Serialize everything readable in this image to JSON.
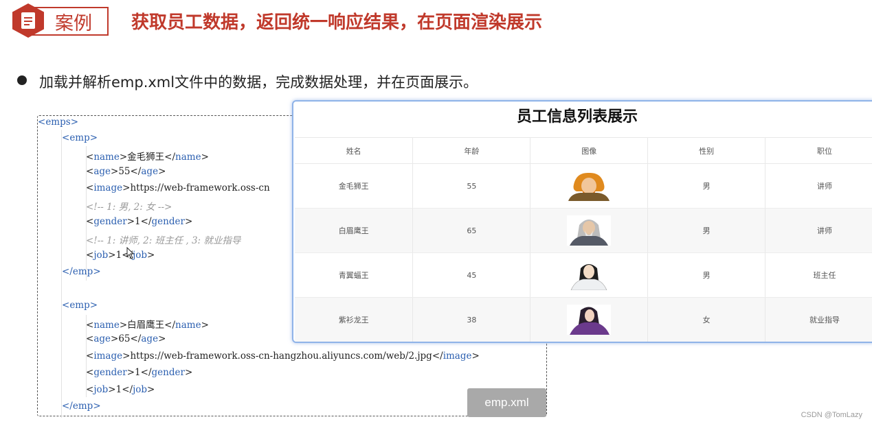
{
  "header": {
    "badge_label": "案例",
    "title": "获取员工数据，返回统一响应结果，在页面渲染展示"
  },
  "bullet": {
    "text": "加载并解析emp.xml文件中的数据，完成数据处理，并在页面展示。"
  },
  "code": {
    "filename": "emp.xml",
    "lines": {
      "emps_open": "emps",
      "emp1_open": "emp",
      "name1_tag": "name",
      "name1_val": "金毛狮王",
      "age1_tag": "age",
      "age1_val": "55",
      "image1_tag": "image",
      "image1_val": "https://web-framework.oss-cn",
      "comment_gender": "<!-- 1: 男, 2: 女 -->",
      "gender1_tag": "gender",
      "gender1_val": "1",
      "comment_job": "<!-- 1: 讲师, 2: 班主任 , 3: 就业指导",
      "job1_tag": "job",
      "job1_val": "1",
      "emp1_close": "emp",
      "emp2_open": "emp",
      "name2_tag": "name",
      "name2_val": "白眉鹰王",
      "age2_tag": "age",
      "age2_val": "65",
      "image2_tag": "image",
      "image2_val": "https://web-framework.oss-cn-hangzhou.aliyuncs.com/web/2.jpg",
      "gender2_tag": "gender",
      "gender2_val": "1",
      "job2_tag": "job",
      "job2_val": "1",
      "emp2_close": "emp"
    }
  },
  "table": {
    "title": "员工信息列表展示",
    "headers": [
      "姓名",
      "年龄",
      "图像",
      "性别",
      "职位"
    ],
    "rows": [
      {
        "name": "金毛狮王",
        "age": "55",
        "gender": "男",
        "job": "讲师",
        "avatar": "golden-lion-avatar"
      },
      {
        "name": "白眉鹰王",
        "age": "65",
        "gender": "男",
        "job": "讲师",
        "avatar": "white-eyebrow-avatar"
      },
      {
        "name": "青翼蝠王",
        "age": "45",
        "gender": "男",
        "job": "班主任",
        "avatar": "green-wing-avatar"
      },
      {
        "name": "紫衫龙王",
        "age": "38",
        "gender": "女",
        "job": "就业指导",
        "avatar": "purple-robe-avatar"
      }
    ]
  },
  "watermark": "CSDN @TomLazy",
  "colors": {
    "accent": "#c0392b",
    "tag_blue": "#2b5fb0",
    "comment_gray": "#999999",
    "card_border": "#8fb3e8"
  }
}
